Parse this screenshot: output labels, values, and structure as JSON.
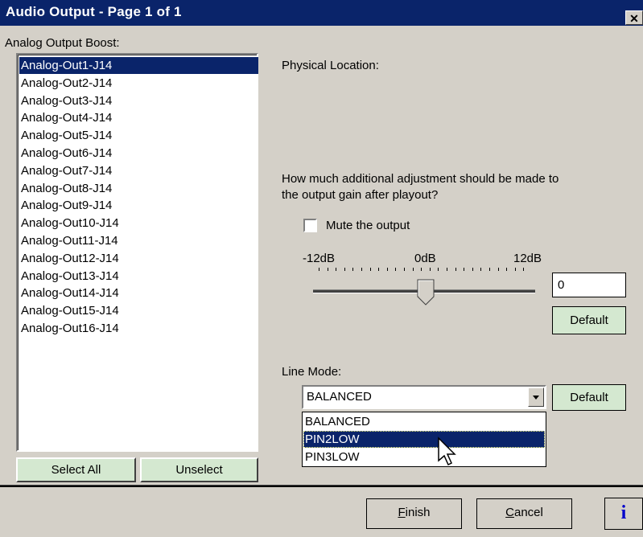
{
  "window": {
    "title": "Audio Output - Page 1 of 1",
    "close_glyph": "✕"
  },
  "left": {
    "label": "Analog Output Boost:",
    "items": [
      "Analog-Out1-J14",
      "Analog-Out2-J14",
      "Analog-Out3-J14",
      "Analog-Out4-J14",
      "Analog-Out5-J14",
      "Analog-Out6-J14",
      "Analog-Out7-J14",
      "Analog-Out8-J14",
      "Analog-Out9-J14",
      "Analog-Out10-J14",
      "Analog-Out11-J14",
      "Analog-Out12-J14",
      "Analog-Out13-J14",
      "Analog-Out14-J14",
      "Analog-Out15-J14",
      "Analog-Out16-J14"
    ],
    "selected_index": 0,
    "select_all": "Select All",
    "unselect": "Unselect"
  },
  "right": {
    "physical_location_label": "Physical Location:",
    "question_line1": "How much additional adjustment should be made to",
    "question_line2": "the output gain after playout?",
    "mute_label": "Mute the output",
    "mute_checked": false,
    "slider": {
      "min_label": "-12dB",
      "mid_label": "0dB",
      "max_label": "12dB",
      "value": 0
    },
    "gain_value": "0",
    "default_label": "Default",
    "line_mode_label": "Line Mode:",
    "line_mode_value": "BALANCED",
    "line_mode_options": [
      "BALANCED",
      "PIN2LOW",
      "PIN3LOW"
    ],
    "highlighted_option": "PIN2LOW",
    "line_mode_default": "Default"
  },
  "footer": {
    "finish_first": "F",
    "finish_rest": "inish",
    "cancel_first": "C",
    "cancel_rest": "ancel",
    "info": "i"
  },
  "colors": {
    "titlebar": "#0a246a",
    "dialog": "#d4d0c8",
    "button_green": "#d4e8d0",
    "info_blue": "#0000cc"
  }
}
